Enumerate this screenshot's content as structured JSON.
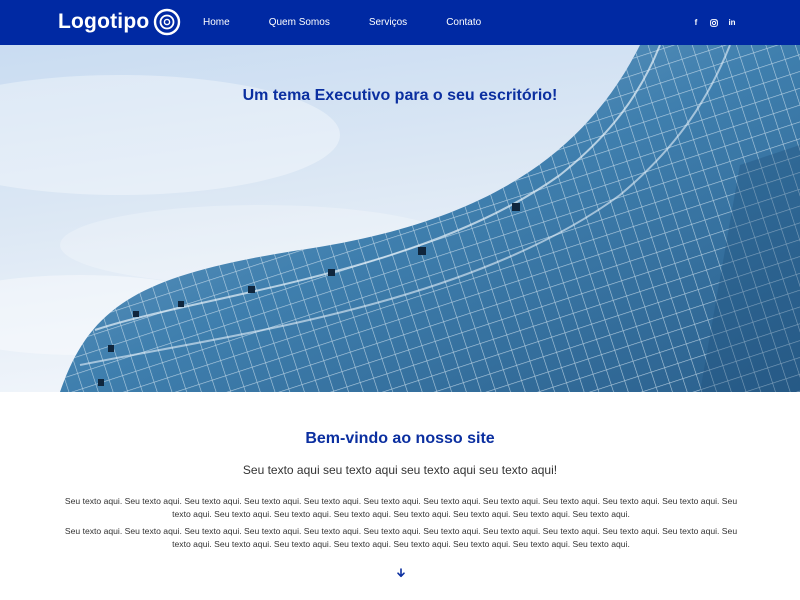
{
  "header": {
    "logo_text": "Logotipo",
    "nav": [
      {
        "label": "Home"
      },
      {
        "label": "Quem Somos"
      },
      {
        "label": "Serviços"
      },
      {
        "label": "Contato"
      }
    ],
    "social": [
      {
        "icon": "facebook-icon",
        "glyph": "f"
      },
      {
        "icon": "instagram-icon"
      },
      {
        "icon": "linkedin-icon",
        "glyph": "in"
      }
    ]
  },
  "hero": {
    "title": "Um tema Executivo para o seu escritório!"
  },
  "welcome": {
    "title_prefix": "Bem-vindo ao ",
    "title_bold": "nosso site",
    "lead": "Seu texto aqui seu texto aqui seu texto aqui seu texto aqui!",
    "paragraphs": [
      "Seu texto aqui. Seu texto aqui. Seu texto aqui. Seu texto aqui. Seu texto aqui. Seu texto aqui. Seu texto aqui. Seu texto aqui. Seu texto aqui. Seu texto aqui. Seu texto aqui. Seu texto aqui. Seu texto aqui. Seu texto aqui. Seu texto aqui. Seu texto aqui. Seu texto aqui. Seu texto aqui. Seu texto aqui.",
      "Seu texto aqui. Seu texto aqui. Seu texto aqui. Seu texto aqui. Seu texto aqui. Seu texto aqui. Seu texto aqui. Seu texto aqui. Seu texto aqui. Seu texto aqui. Seu texto aqui. Seu texto aqui. Seu texto aqui. Seu texto aqui. Seu texto aqui. Seu texto aqui. Seu texto aqui. Seu texto aqui. Seu texto aqui."
    ]
  },
  "colors": {
    "header_bg": "#0029a3",
    "accent_text": "#0b2fa0"
  },
  "icons": {
    "scroll": "arrow-down-icon",
    "logo": "target-circle-icon"
  }
}
